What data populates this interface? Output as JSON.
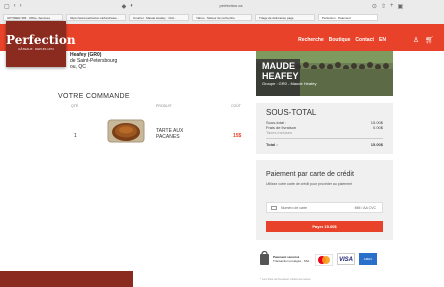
{
  "browser": {
    "url": "perfection.ca",
    "tabs": [
      "UPTIMER 365 · Office, Services",
      "https://www.perfection.ca/fundraise...",
      "Courriel · Maude Heafey · Outl...",
      "Yahoo · Moteur de recherche",
      "Triage de délivrance page",
      "Perfection · Paiement"
    ]
  },
  "brand": {
    "name": "Perfection",
    "tagline": "GÂTEAUX · DEPUIS 1974"
  },
  "nav": {
    "links": [
      "Recherche",
      "Boutique",
      "Contact",
      "EN"
    ]
  },
  "customer": {
    "lines": [
      "Heafey (GR0)",
      "de Saint-Petersbourg",
      "ou, QC"
    ]
  },
  "group": {
    "name_line1": "MAUDE",
    "name_line2": "HEAFEY",
    "subtitle": "Groupe : GR0 - Maude Heafey"
  },
  "order": {
    "title": "VOTRE COMMANDE",
    "headers": {
      "qty": "QTÉ",
      "product": "PRODUIT",
      "cost": "COÛT"
    },
    "item": {
      "qty": "1",
      "name_line1": "TARTE AUX",
      "name_line2": "PACANES",
      "price": "15$"
    }
  },
  "subtotal": {
    "title": "SOUS-TOTAL",
    "rows": [
      {
        "label": "Sous-total :",
        "value": "15.00$"
      },
      {
        "label": "Frais de livraison",
        "value": "0.00$"
      },
      {
        "label": "Taxes incluses",
        "value": ""
      }
    ],
    "total_label": "Total :",
    "total_value": "15.00$"
  },
  "payment": {
    "title": "Paiement par carte de crédit",
    "description": "Utilisez votre carte de crédit pour procéder au paiement",
    "card_placeholder": "Numéro de carte",
    "expiry_placeholder": "MM / AA  CVC",
    "pay_button": "Payer 15.00$"
  },
  "security": {
    "label": "Paiement sécurisé",
    "sub": "Transaction protégée · SSL",
    "visa": "VISA",
    "amex": "AMEX"
  },
  "footer": {
    "note": "* Les frais de livraison inclus les taxes"
  }
}
